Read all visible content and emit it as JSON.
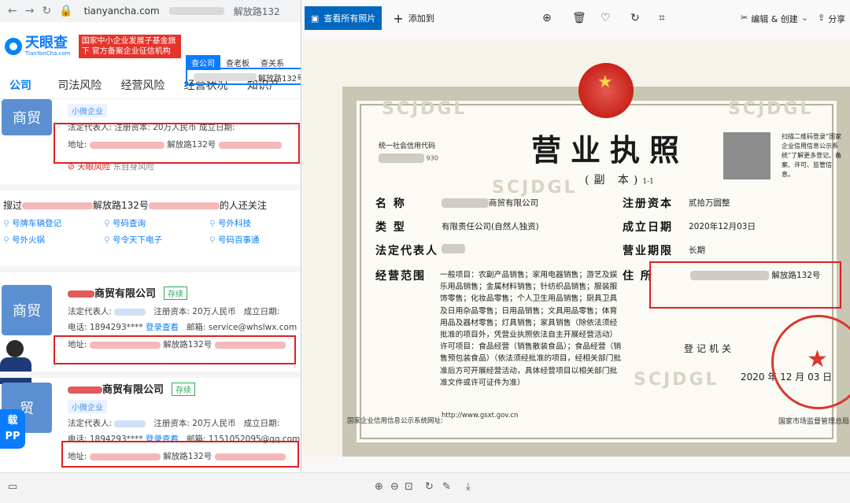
{
  "browser": {
    "url": "tianyancha.com",
    "search_suffix": "解放路132"
  },
  "site": {
    "logo_text": "天眼查",
    "logo_sub": "TianYanCha.com",
    "gov_badge": "国家中小企业发展子基金旗下 官方备案企业征信机构",
    "search_tabs": [
      "查公司",
      "查老板",
      "查关系"
    ],
    "search_value": "解放路132号",
    "nav": [
      "公司",
      "司法风险",
      "经营风险",
      "经营状况",
      "知识产"
    ]
  },
  "card1": {
    "avatar": "商贸",
    "tag": "小微企业",
    "line1": "法定代表人:     注册资本: 20万人民币   成立日期:",
    "addr_label": "地址:",
    "addr_value": "解放路132号",
    "risk": "天眼风险",
    "risk2": "东自身风险"
  },
  "section": {
    "title_prefix": "搜过",
    "title_mid": "解放路132号",
    "title_suffix": "的人还关注",
    "links": [
      "号牌车辆登记",
      "号码查询",
      "号外科技",
      "号外火锅",
      "号令天下电子",
      "号码百事通"
    ]
  },
  "card2": {
    "avatar": "商贸",
    "name": "商贸有限公司",
    "status": "存续",
    "legal": "法定代表人:",
    "capital": "注册资本: 20万人民币",
    "founded": "成立日期:",
    "phone": "电话: 1894293****",
    "login": "登录查看",
    "email": "邮箱: service@whslwx.com",
    "addr_label": "地址:",
    "addr_value": "解放路132号"
  },
  "card3": {
    "avatar": "贸",
    "name": "商贸有限公司",
    "status": "存续",
    "tag": "小微企业",
    "legal": "法定代表人:",
    "capital": "注册资本: 20万人民币",
    "founded": "成立日期:",
    "phone": "电话: 1894293****",
    "login": "登录查看",
    "email": "邮箱: 1151052095@qq.com",
    "addr_label": "地址:",
    "addr_value": "解放路132号"
  },
  "app_badge": "载\nPP",
  "viewer": {
    "view_all": "查看所有照片",
    "add_to": "添加到",
    "edit_create": "编辑 & 创建",
    "share": "分享"
  },
  "cert": {
    "watermark": "SCJDGL",
    "title": "营业执照",
    "subtitle": "(副  本)",
    "subtitle_no": "1-1",
    "code_label": "统一社会信用代码",
    "code_value": "930",
    "qr_text": "扫描二维码登录“国家企业信用信息公示系统”了解更多登记、备案、许可、监管信息。",
    "name_label": "名    称",
    "name_value": "商贸有限公司",
    "type_label": "类    型",
    "type_value": "有限责任公司(自然人独资)",
    "legal_label": "法定代表人",
    "scope_label": "经营范围",
    "scope_value": "一般项目：农副产品销售；家用电器销售；游艺及娱乐用品销售；金属材料销售；针纺织品销售；服装服饰零售；化妆品零售；个人卫生用品销售；厨具卫具及日用杂品零售；日用品销售；文具用品零售；体育用品及器材零售；灯具销售；家具销售（除依法须经批准的项目外，凭营业执照依法自主开展经营活动）许可项目：食品经营（销售散装食品）；食品经营（销售预包装食品）（依法须经批准的项目，经相关部门批准后方可开展经营活动，具体经营项目以相关部门批准文件或许可证件为准）",
    "capital_label": "注册资本",
    "capital_value": "贰拾万圆整",
    "founded_label": "成立日期",
    "founded_value": "2020年12月03日",
    "term_label": "营业期限",
    "term_value": "长期",
    "addr_label": "住    所",
    "addr_value": "解放路132号",
    "authority": "登记机关",
    "date": "2020 年 12 月 03 日",
    "footer_left": "国家企业信用信息公示系统网址:",
    "footer_url": "http://www.gsxt.gov.cn",
    "footer_right": "国家市场监督管理总局"
  }
}
